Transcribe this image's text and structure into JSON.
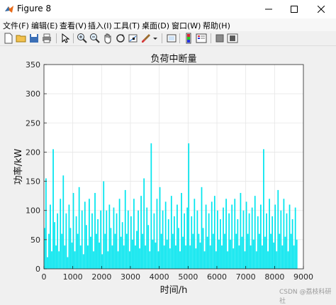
{
  "window": {
    "title": "Figure 8"
  },
  "menu": {
    "items": [
      "文件(F)",
      "编辑(E)",
      "查看(V)",
      "插入(I)",
      "工具(T)",
      "桌面(D)",
      "窗口(W)",
      "帮助(H)"
    ]
  },
  "toolbar": {
    "icons": [
      "new-figure-icon",
      "open-file-icon",
      "save-icon",
      "print-icon",
      "pointer-icon",
      "zoom-in-icon",
      "zoom-out-icon",
      "pan-hand-icon",
      "rotate-3d-icon",
      "data-cursor-icon",
      "brush-icon",
      "insert-colorbar-icon",
      "insert-legend-icon",
      "hide-plot-tools-icon",
      "show-plot-tools-icon"
    ]
  },
  "colors": {
    "series": "#00e5ee",
    "axes_bg": "#ffffff",
    "figure_bg": "#f0f0f0",
    "grid": "#e6e6e6"
  },
  "chart_data": {
    "type": "bar",
    "title": "负荷中断量",
    "xlabel": "时间/h",
    "ylabel": "功率/kW",
    "xlim": [
      0,
      9000
    ],
    "ylim": [
      0,
      350
    ],
    "xticks": [
      0,
      1000,
      2000,
      3000,
      4000,
      5000,
      6000,
      7000,
      8000,
      9000
    ],
    "yticks": [
      0,
      50,
      100,
      150,
      200,
      250,
      300,
      350
    ],
    "grid": true,
    "series_color": "#00e5ee",
    "series": [
      {
        "x_start": 0,
        "x_step": 50,
        "values": [
          70,
          155,
          20,
          60,
          110,
          30,
          205,
          80,
          40,
          95,
          30,
          120,
          60,
          160,
          40,
          95,
          20,
          110,
          70,
          45,
          130,
          30,
          90,
          60,
          140,
          40,
          100,
          25,
          115,
          75,
          40,
          120,
          55,
          95,
          30,
          130,
          60,
          85,
          45,
          100,
          25,
          150,
          60,
          100,
          30,
          110,
          70,
          40,
          105,
          60,
          95,
          30,
          120,
          55,
          80,
          40,
          135,
          60,
          100,
          30,
          90,
          50,
          120,
          40,
          65,
          100,
          35,
          125,
          60,
          155,
          40,
          105,
          75,
          30,
          215,
          50,
          95,
          45,
          120,
          30,
          140,
          60,
          100,
          40,
          115,
          50,
          85,
          35,
          125,
          60,
          90,
          40,
          110,
          70,
          30,
          130,
          55,
          95,
          40,
          105,
          215,
          40,
          90,
          60,
          120,
          35,
          100,
          60,
          45,
          140,
          70,
          30,
          110,
          55,
          95,
          40,
          115,
          60,
          125,
          30,
          100,
          50,
          85,
          40,
          105,
          60,
          120,
          30,
          95,
          50,
          110,
          35,
          120,
          60,
          85,
          40,
          130,
          55,
          100,
          30,
          115,
          60,
          95,
          40,
          105,
          50,
          125,
          30,
          90,
          60,
          110,
          40,
          205,
          55,
          95,
          30,
          120,
          60,
          90,
          45,
          110,
          30,
          135,
          60,
          100,
          40,
          120,
          55,
          95,
          30,
          110,
          60,
          85,
          40,
          105,
          50
        ]
      }
    ]
  },
  "watermark": "CSDN @荔枝科研社"
}
